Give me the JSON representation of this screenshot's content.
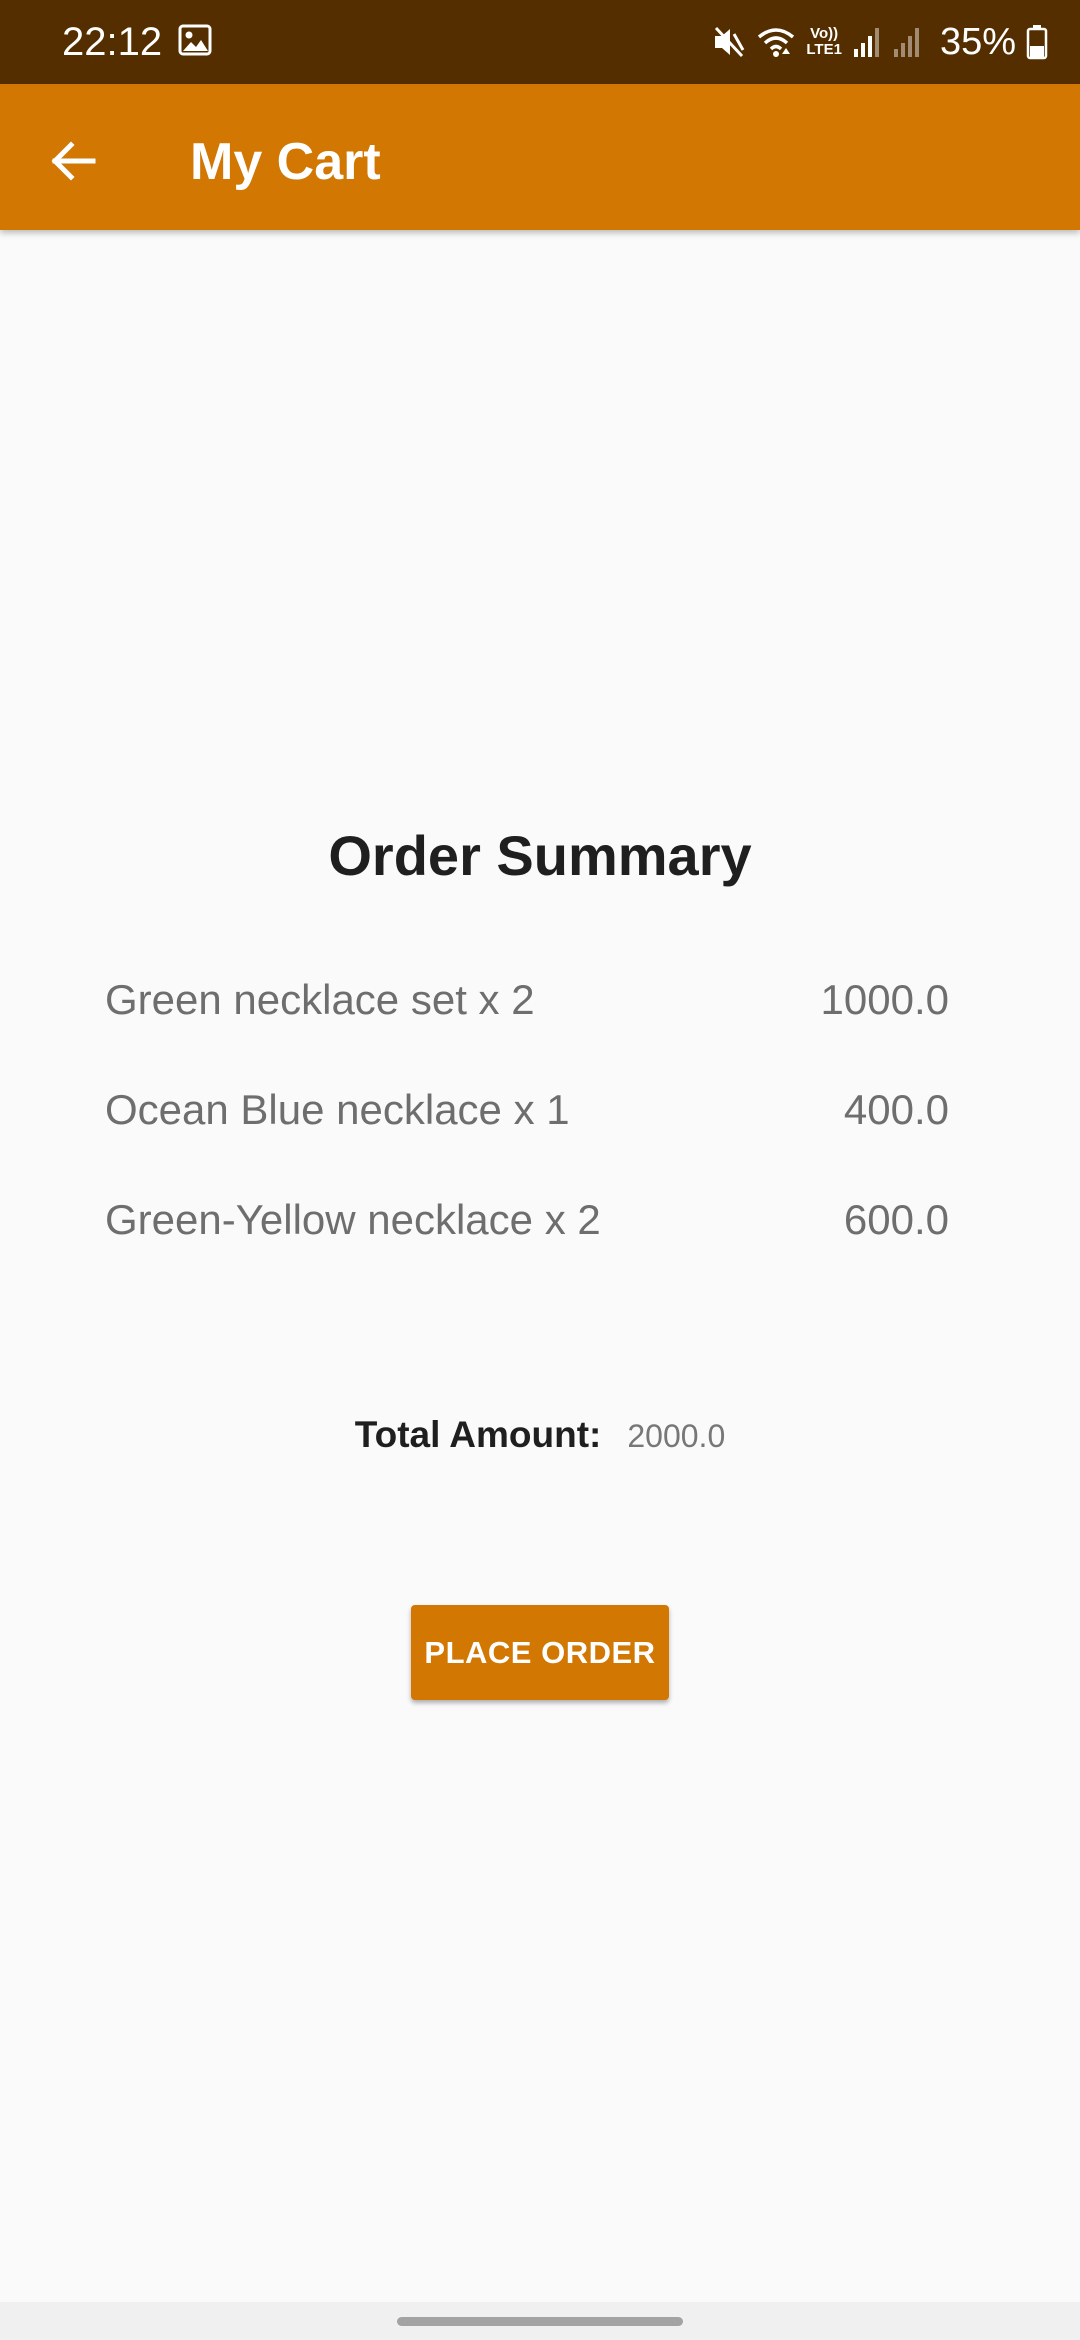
{
  "status_bar": {
    "time": "22:12",
    "battery": "35%",
    "icons": [
      "gallery-icon",
      "mute-icon",
      "wifi-icon",
      "volte-icon",
      "signal-icon",
      "signal-icon",
      "battery-icon"
    ],
    "volte_top": "Vo))",
    "volte_bottom": "LTE1"
  },
  "app_bar": {
    "title": "My Cart",
    "back_icon": "arrow-back-icon",
    "color": "#d17702"
  },
  "summary": {
    "title": "Order Summary",
    "items": [
      {
        "name": "Green necklace set x 2",
        "price": "1000.0"
      },
      {
        "name": "Ocean Blue necklace x 1",
        "price": "400.0"
      },
      {
        "name": "Green-Yellow necklace x 2",
        "price": "600.0"
      }
    ],
    "total_label": "Total Amount:",
    "total_value": "2000.0"
  },
  "actions": {
    "place_order_label": "PLACE ORDER"
  },
  "colors": {
    "status_bar": "#552e00",
    "accent": "#d17702",
    "background": "#fafafa"
  }
}
